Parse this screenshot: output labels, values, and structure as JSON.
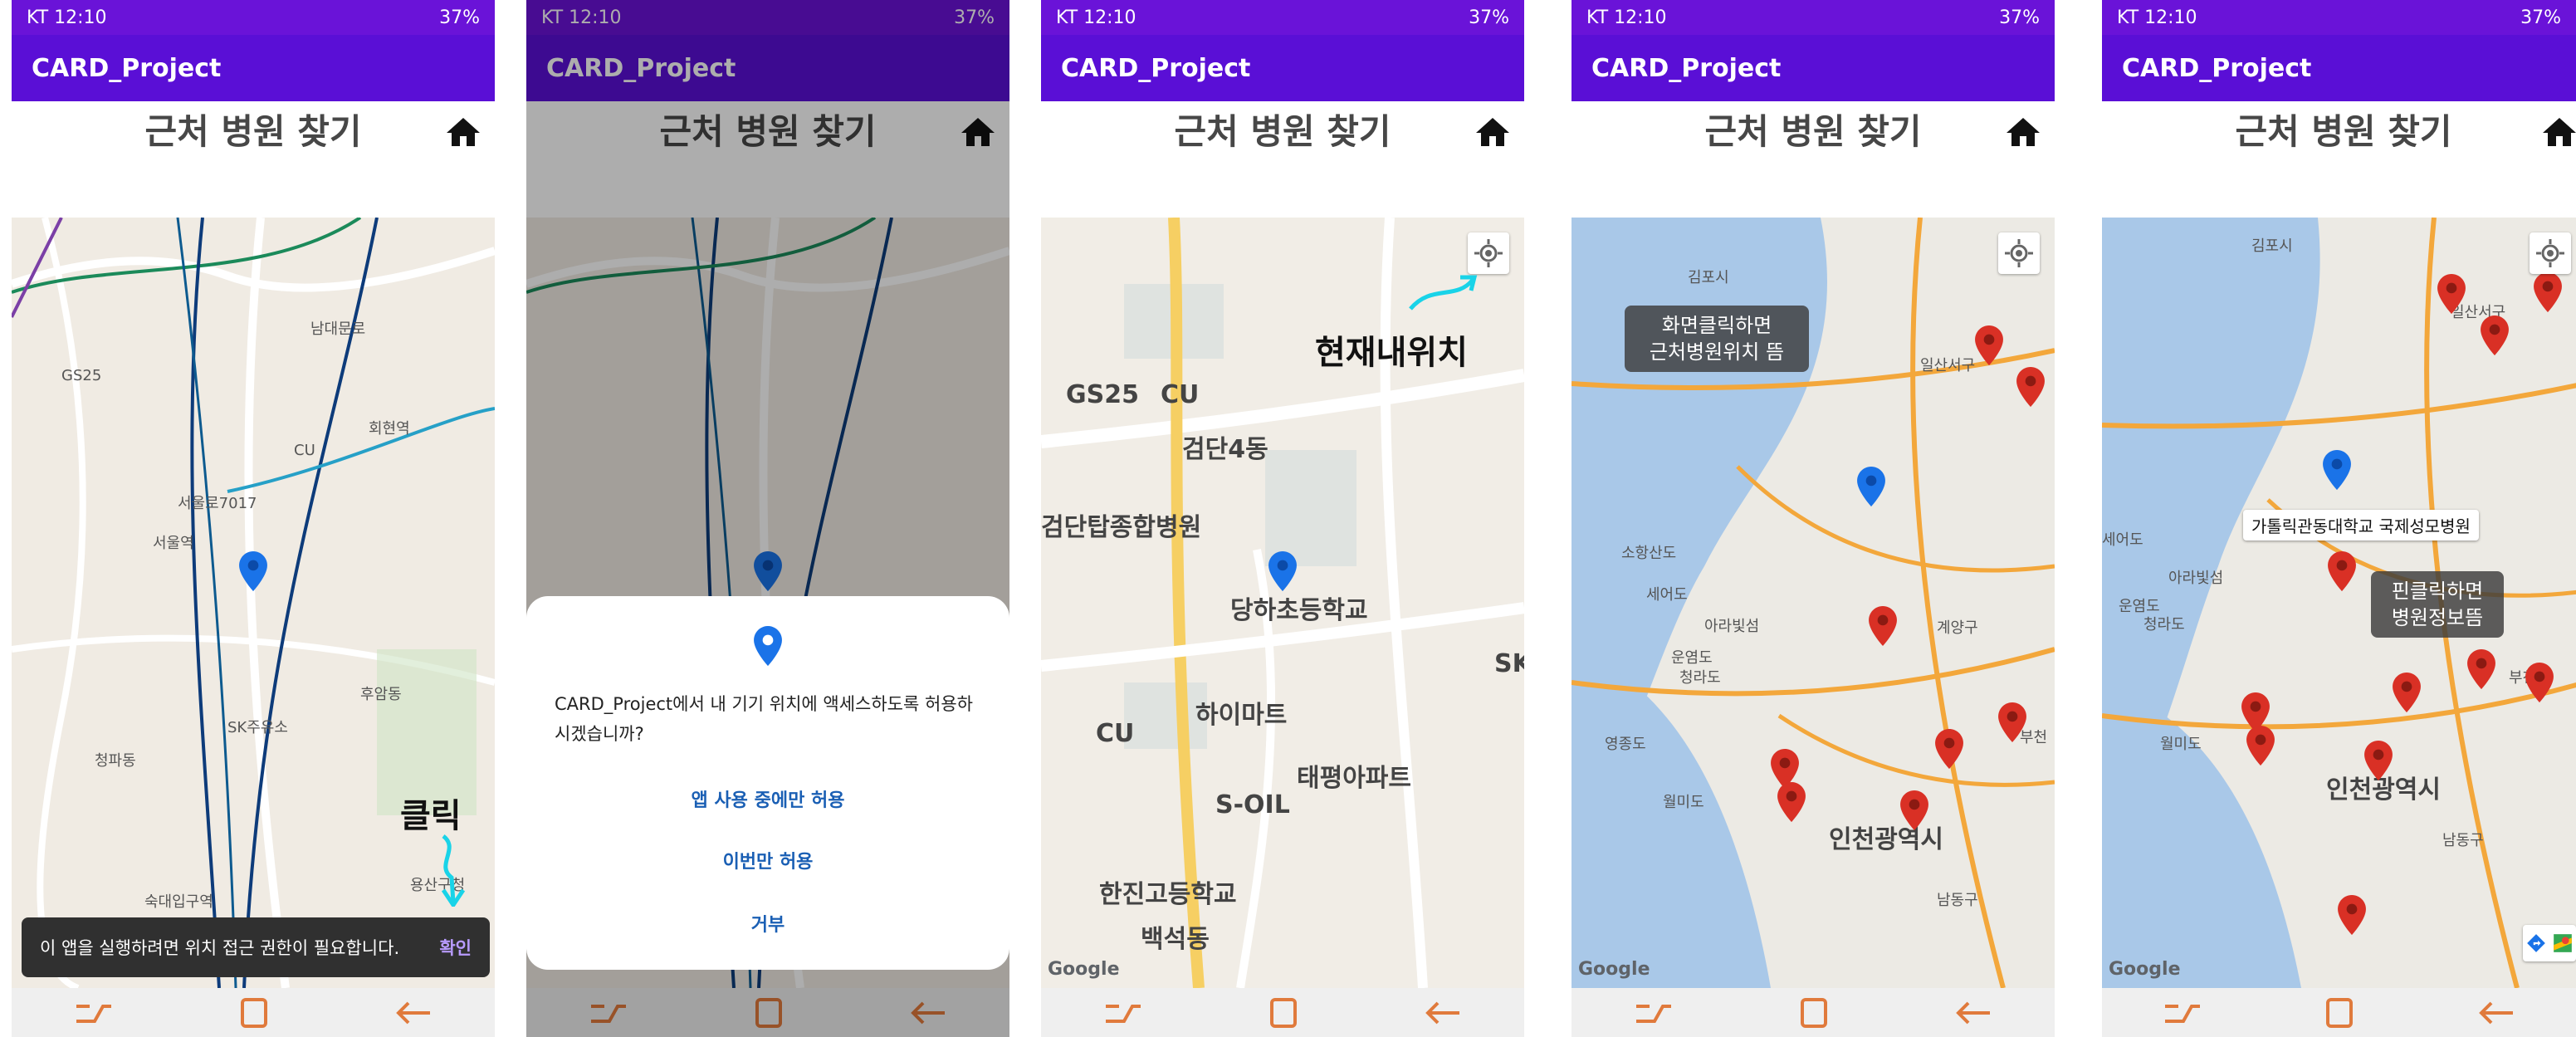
{
  "status": {
    "carrier": "KT 12:10",
    "right": "37%"
  },
  "app": {
    "name": "CARD_Project"
  },
  "page": {
    "title": "근처 병원 찾기"
  },
  "screen1": {
    "toast_message": "이 앱을 실행하려면 위치 접근 권한이 필요합니다.",
    "toast_action": "확인",
    "annotation": "클릭",
    "labels": [
      "서울역",
      "남대문로",
      "회현역",
      "GS25",
      "CU",
      "청파동",
      "숙대입구역",
      "용산구청",
      "서울로7017",
      "후암동",
      "SK주유소"
    ]
  },
  "screen2": {
    "dialog_message": "CARD_Project에서 내 기기 위치에 액세스하도록 허용하시겠습니까?",
    "allow_while_using": "앱 사용 중에만 허용",
    "allow_once": "이번만 허용",
    "deny": "거부"
  },
  "screen3": {
    "annotation": "현재내위치",
    "labels": [
      "GS25",
      "CU",
      "검단4동",
      "검단탑종합병원",
      "당하초등학교",
      "하이마트",
      "태평아파트",
      "S-OIL",
      "한진고등학교",
      "백석동",
      "SK",
      "CU"
    ]
  },
  "screen4": {
    "note_line1": "화면클릭하면",
    "note_line2": "근처병원위치 뜸",
    "labels": [
      "김포시",
      "일산서구",
      "소항산도",
      "세어도",
      "아라빛섬",
      "운염도",
      "청라도",
      "영종도",
      "월미도",
      "인천광역시",
      "계양구",
      "부천",
      "남동구"
    ]
  },
  "screen5": {
    "callout": "가톨릭관동대학교 국제성모병원",
    "note_line1": "핀클릭하면",
    "note_line2": "병원정보뜸",
    "labels": [
      "일산서구",
      "세어도",
      "아라빛섬",
      "운염도",
      "청라도",
      "월미도",
      "인천광역시",
      "부천",
      "남동구",
      "김포시"
    ]
  },
  "google": "Google",
  "colors": {
    "statusbar": "#6a13d8",
    "appbar": "#5a0fd6",
    "marker_blue": "#1a73e8",
    "marker_red": "#d93025",
    "accent": "#00bcd4"
  }
}
